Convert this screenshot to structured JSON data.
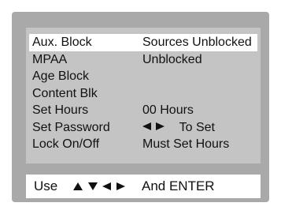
{
  "menu": {
    "rows": [
      {
        "label": "Aux. Block",
        "value": "Sources Unblocked",
        "selected": true
      },
      {
        "label": "MPAA",
        "value": "Unblocked",
        "selected": false
      },
      {
        "label": "Age Block",
        "value": "",
        "selected": false
      },
      {
        "label": "Content Blk",
        "value": "",
        "selected": false
      },
      {
        "label": "Set Hours",
        "value": "00 Hours",
        "selected": false
      },
      {
        "label": "Set Password",
        "value": "To Set",
        "value_icons": [
          "left-arrow-icon",
          "right-arrow-icon"
        ],
        "selected": false
      },
      {
        "label": "Lock On/Off",
        "value": "Must Set Hours",
        "selected": false
      }
    ]
  },
  "help": {
    "prefix": "Use",
    "icons": [
      "up-arrow-icon",
      "down-arrow-icon",
      "left-arrow-icon",
      "right-arrow-icon"
    ],
    "suffix": "And ENTER"
  },
  "colors": {
    "frame": "#a9a9a9",
    "panel": "#c4c4c4",
    "highlight": "#ffffff",
    "text": "#111111"
  }
}
